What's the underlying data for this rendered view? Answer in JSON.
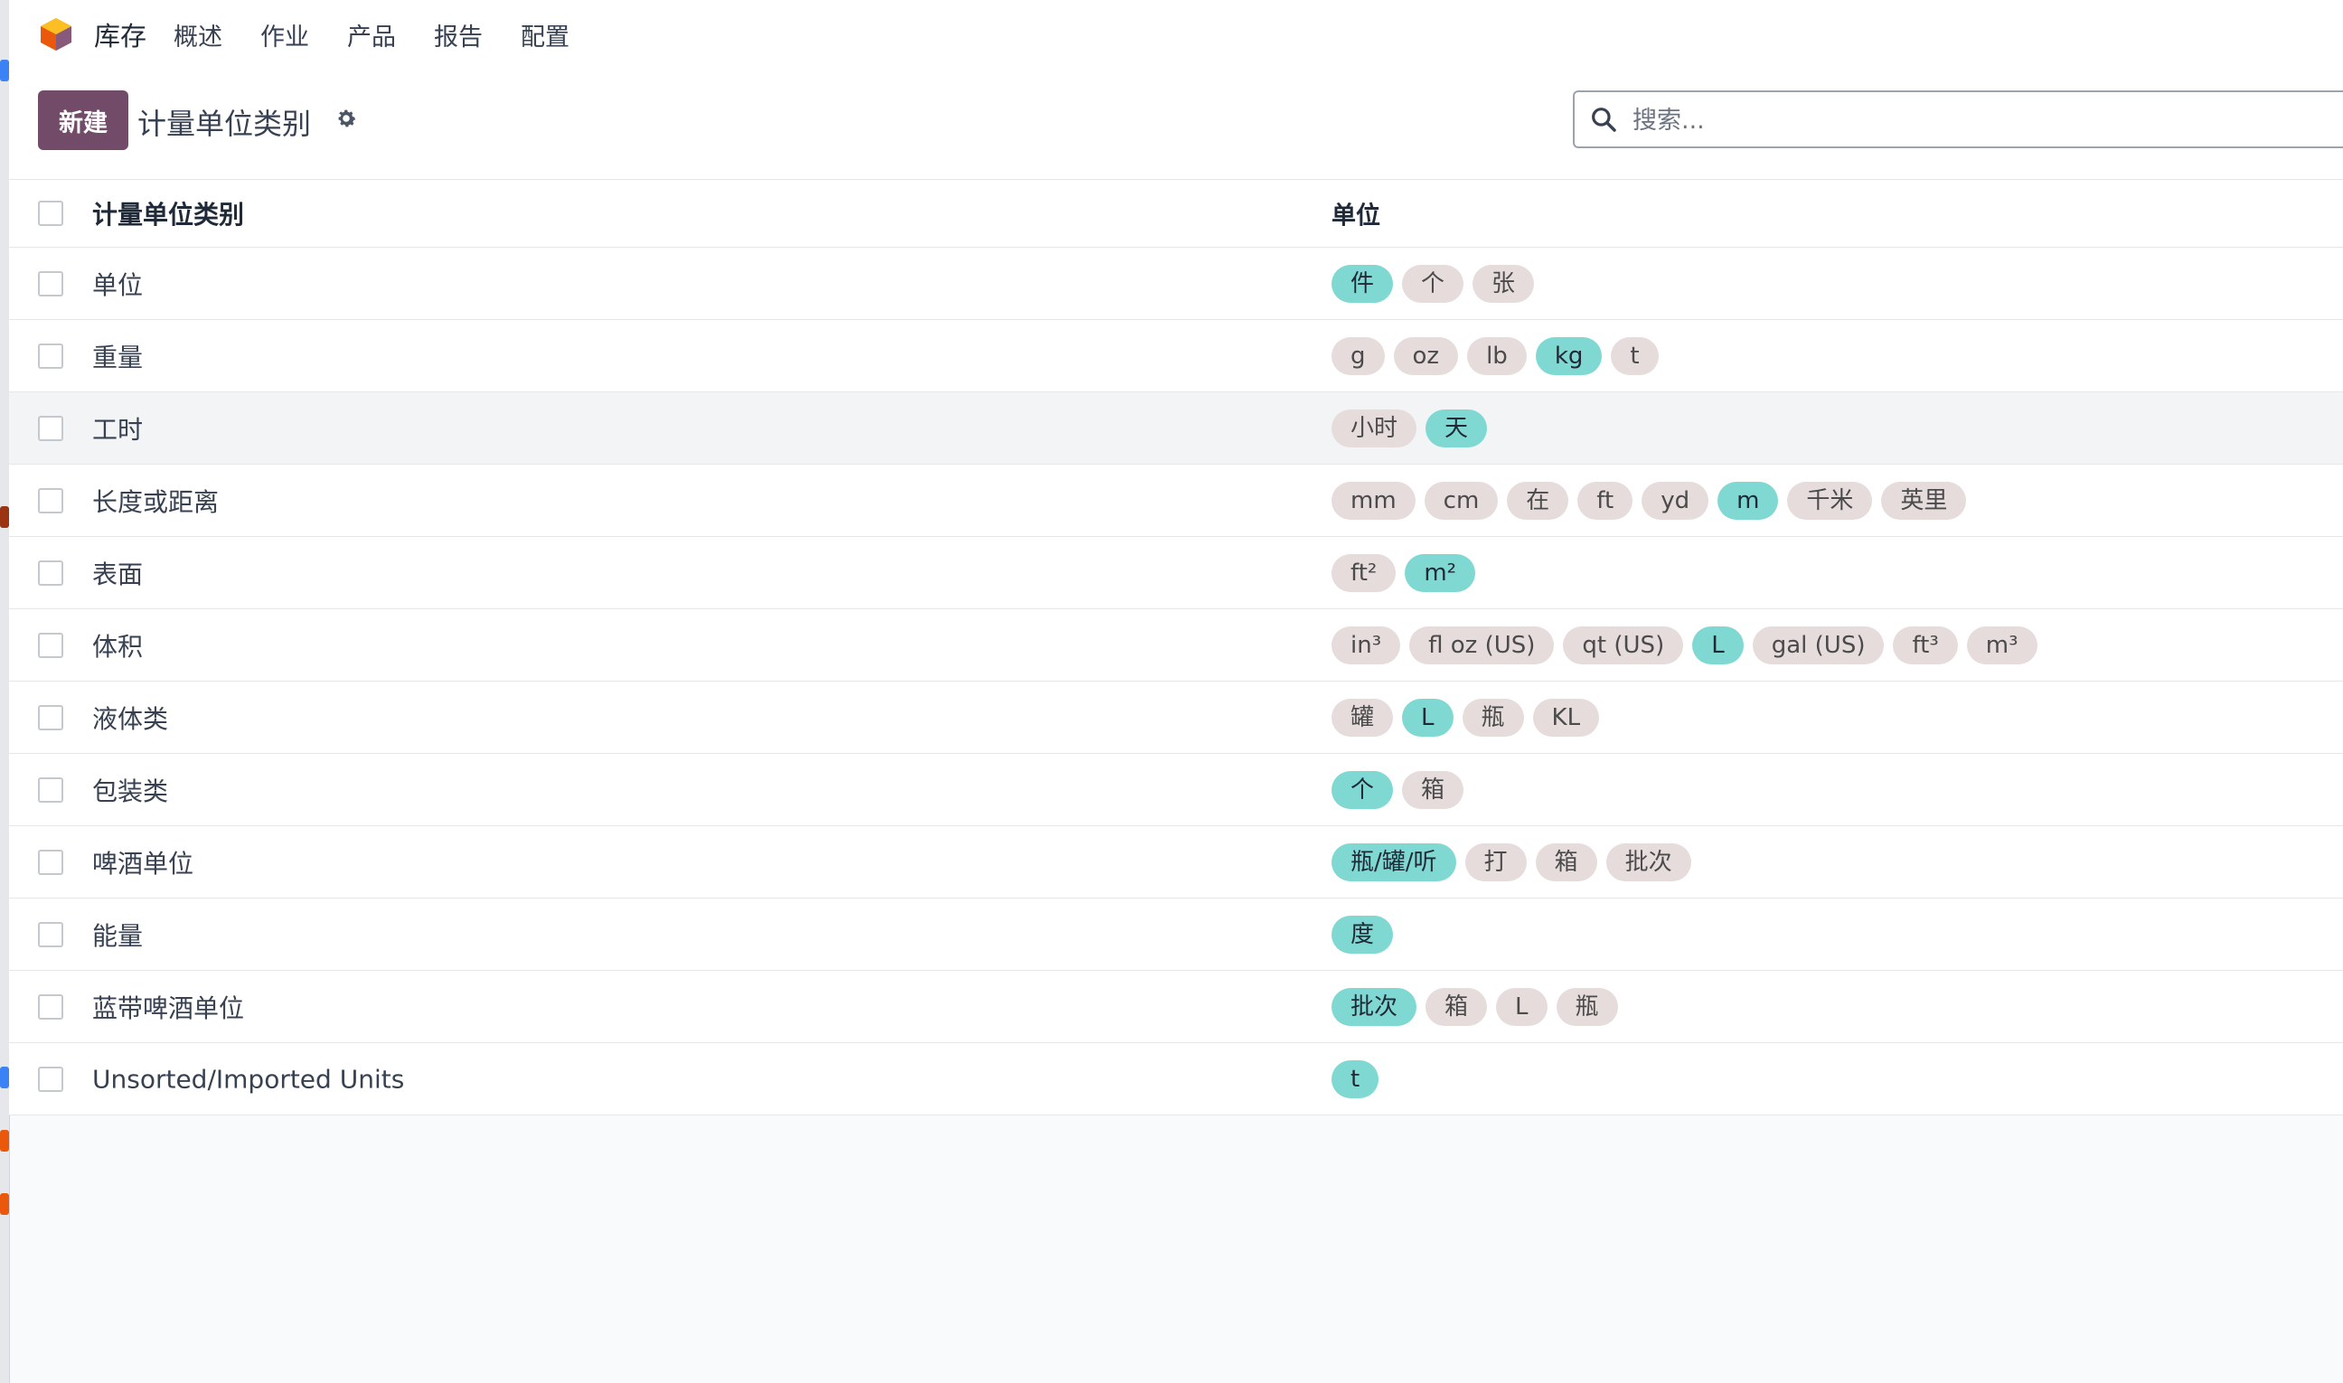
{
  "navbar": {
    "app_title": "库存",
    "menu": [
      "概述",
      "作业",
      "产品",
      "报告",
      "配置"
    ]
  },
  "control_panel": {
    "new_button": "新建",
    "page_title": "计量单位类别",
    "search_placeholder": "搜索..."
  },
  "table": {
    "headers": {
      "name": "计量单位类别",
      "units": "单位"
    },
    "rows": [
      {
        "name": "单位",
        "units": [
          {
            "label": "件",
            "reference": true
          },
          {
            "label": "个",
            "reference": false
          },
          {
            "label": "张",
            "reference": false
          }
        ]
      },
      {
        "name": "重量",
        "units": [
          {
            "label": "g",
            "reference": false
          },
          {
            "label": "oz",
            "reference": false
          },
          {
            "label": "lb",
            "reference": false
          },
          {
            "label": "kg",
            "reference": true
          },
          {
            "label": "t",
            "reference": false
          }
        ]
      },
      {
        "name": "工时",
        "units": [
          {
            "label": "小时",
            "reference": false
          },
          {
            "label": "天",
            "reference": true
          }
        ],
        "hover": true
      },
      {
        "name": "长度或距离",
        "units": [
          {
            "label": "mm",
            "reference": false
          },
          {
            "label": "cm",
            "reference": false
          },
          {
            "label": "在",
            "reference": false
          },
          {
            "label": "ft",
            "reference": false
          },
          {
            "label": "yd",
            "reference": false
          },
          {
            "label": "m",
            "reference": true
          },
          {
            "label": "千米",
            "reference": false
          },
          {
            "label": "英里",
            "reference": false
          }
        ]
      },
      {
        "name": "表面",
        "units": [
          {
            "label": "ft²",
            "reference": false
          },
          {
            "label": "m²",
            "reference": true
          }
        ]
      },
      {
        "name": "体积",
        "units": [
          {
            "label": "in³",
            "reference": false
          },
          {
            "label": "fl oz (US)",
            "reference": false
          },
          {
            "label": "qt (US)",
            "reference": false
          },
          {
            "label": "L",
            "reference": true
          },
          {
            "label": "gal (US)",
            "reference": false
          },
          {
            "label": "ft³",
            "reference": false
          },
          {
            "label": "m³",
            "reference": false
          }
        ]
      },
      {
        "name": "液体类",
        "units": [
          {
            "label": "罐",
            "reference": false
          },
          {
            "label": "L",
            "reference": true
          },
          {
            "label": "瓶",
            "reference": false
          },
          {
            "label": "KL",
            "reference": false
          }
        ]
      },
      {
        "name": "包装类",
        "units": [
          {
            "label": "个",
            "reference": true
          },
          {
            "label": "箱",
            "reference": false
          }
        ]
      },
      {
        "name": "啤酒单位",
        "units": [
          {
            "label": "瓶/罐/听",
            "reference": true
          },
          {
            "label": "打",
            "reference": false
          },
          {
            "label": "箱",
            "reference": false
          },
          {
            "label": "批次",
            "reference": false
          }
        ]
      },
      {
        "name": "能量",
        "units": [
          {
            "label": "度",
            "reference": true
          }
        ]
      },
      {
        "name": "蓝带啤酒单位",
        "units": [
          {
            "label": "批次",
            "reference": true
          },
          {
            "label": "箱",
            "reference": false
          },
          {
            "label": "L",
            "reference": false
          },
          {
            "label": "瓶",
            "reference": false
          }
        ]
      },
      {
        "name": "Unsorted/Imported Units",
        "units": [
          {
            "label": "t",
            "reference": true
          }
        ]
      }
    ]
  },
  "colors": {
    "brand": "#714b67",
    "reference_tag": "#7fd9d2",
    "tag": "#e6dcdc"
  }
}
